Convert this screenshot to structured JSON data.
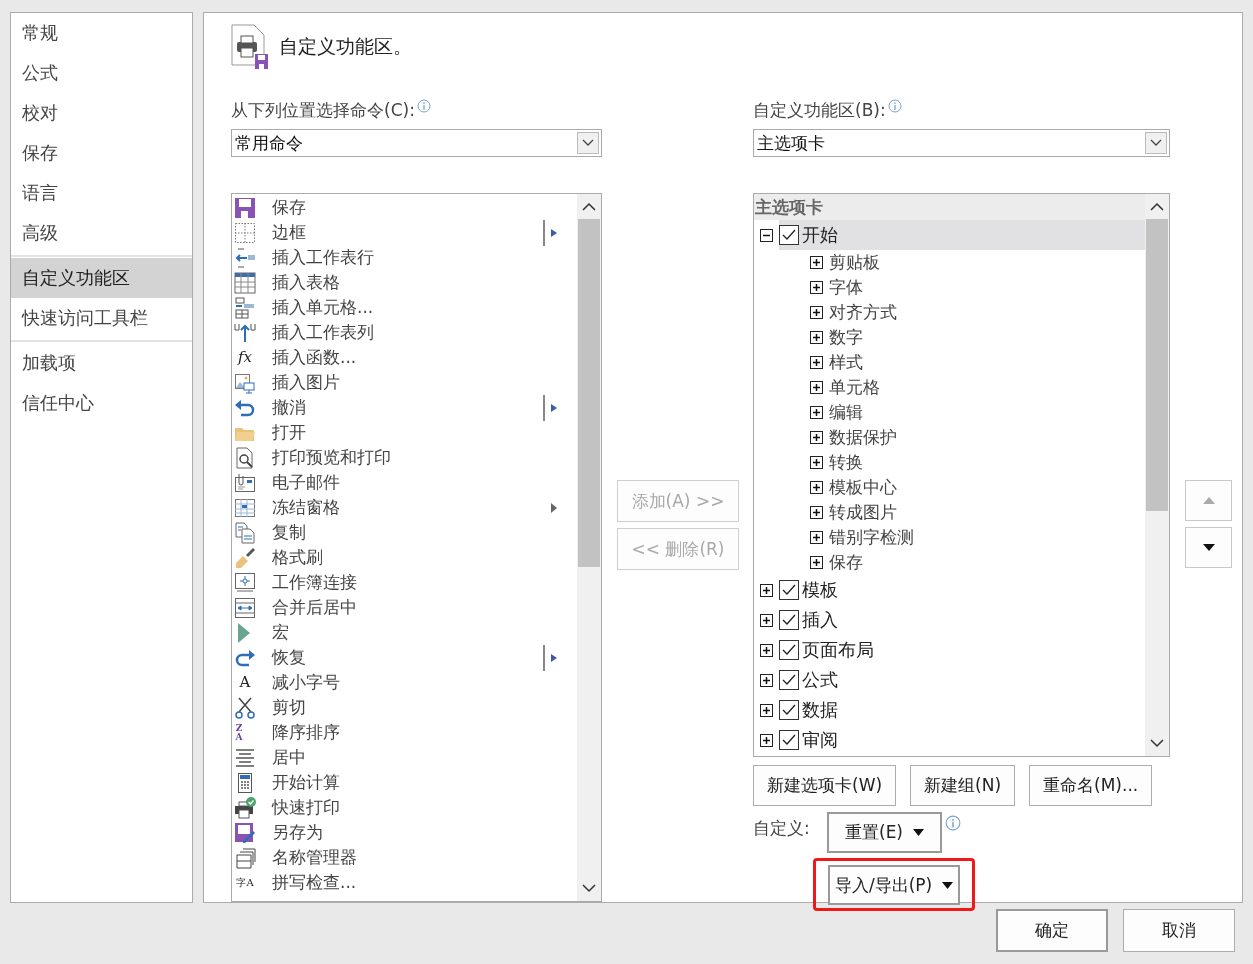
{
  "sidebar": {
    "groups": [
      [
        {
          "label": "常规",
          "selected": false
        },
        {
          "label": "公式",
          "selected": false
        },
        {
          "label": "校对",
          "selected": false
        },
        {
          "label": "保存",
          "selected": false
        },
        {
          "label": "语言",
          "selected": false
        },
        {
          "label": "高级",
          "selected": false
        }
      ],
      [
        {
          "label": "自定义功能区",
          "selected": true
        },
        {
          "label": "快速访问工具栏",
          "selected": false
        }
      ],
      [
        {
          "label": "加载项",
          "selected": false
        },
        {
          "label": "信任中心",
          "selected": false
        }
      ]
    ]
  },
  "header": {
    "title": "自定义功能区。"
  },
  "commands": {
    "label": "从下列位置选择命令(C):",
    "dropdown": {
      "value": "常用命令"
    },
    "items": [
      {
        "label": "保存"
      },
      {
        "label": "边框",
        "kind": "split"
      },
      {
        "label": "插入工作表行"
      },
      {
        "label": "插入表格"
      },
      {
        "label": "插入单元格..."
      },
      {
        "label": "插入工作表列"
      },
      {
        "label": "插入函数...",
        "glyph": "fx"
      },
      {
        "label": "插入图片"
      },
      {
        "label": "撤消",
        "kind": "split"
      },
      {
        "label": "打开"
      },
      {
        "label": "打印预览和打印"
      },
      {
        "label": "电子邮件"
      },
      {
        "label": "冻结窗格",
        "kind": "menu"
      },
      {
        "label": "复制"
      },
      {
        "label": "格式刷"
      },
      {
        "label": "工作簿连接"
      },
      {
        "label": "合并后居中"
      },
      {
        "label": "宏"
      },
      {
        "label": "恢复",
        "kind": "split"
      },
      {
        "label": "减小字号",
        "glyph": "A"
      },
      {
        "label": "剪切"
      },
      {
        "label": "降序排序",
        "glyph": "ZA"
      },
      {
        "label": "居中"
      },
      {
        "label": "开始计算"
      },
      {
        "label": "快速打印"
      },
      {
        "label": "另存为"
      },
      {
        "label": "名称管理器"
      },
      {
        "label": "拼写检查...",
        "glyph": "字A"
      }
    ]
  },
  "transfer_buttons": [
    {
      "label": "添加(A) >>",
      "disabled": true
    },
    {
      "label": "<< 删除(R)",
      "disabled": true
    }
  ],
  "ribbon": {
    "label": "自定义功能区(B):",
    "dropdown": {
      "value": "主选项卡"
    },
    "tree": {
      "heading": "主选项卡",
      "tabs": [
        {
          "label": "开始",
          "checked": true,
          "expanded": true,
          "selected": true,
          "children": [
            {
              "label": "剪贴板",
              "expanded": false
            },
            {
              "label": "字体",
              "expanded": false
            },
            {
              "label": "对齐方式",
              "expanded": false
            },
            {
              "label": "数字",
              "expanded": false
            },
            {
              "label": "样式",
              "expanded": false
            },
            {
              "label": "单元格",
              "expanded": false
            },
            {
              "label": "编辑",
              "expanded": false
            },
            {
              "label": "数据保护",
              "expanded": false
            },
            {
              "label": "转换",
              "expanded": false
            },
            {
              "label": "模板中心",
              "expanded": false
            },
            {
              "label": "转成图片",
              "expanded": false
            },
            {
              "label": "错别字检测",
              "expanded": false
            },
            {
              "label": "保存",
              "expanded": false
            }
          ]
        },
        {
          "label": "模板",
          "checked": true,
          "expanded": false,
          "selected": false
        },
        {
          "label": "插入",
          "checked": true,
          "expanded": false,
          "selected": false
        },
        {
          "label": "页面布局",
          "checked": true,
          "expanded": false,
          "selected": false
        },
        {
          "label": "公式",
          "checked": true,
          "expanded": false,
          "selected": false
        },
        {
          "label": "数据",
          "checked": true,
          "expanded": false,
          "selected": false
        },
        {
          "label": "审阅",
          "checked": true,
          "expanded": false,
          "selected": false
        }
      ]
    },
    "buttons": [
      "新建选项卡(W)",
      "新建组(N)",
      "重命名(M)..."
    ],
    "customize": {
      "label": "自定义:",
      "reset": "重置(E)",
      "import_export": "导入/导出(P)",
      "highlighted": true
    }
  },
  "move_buttons": [
    {
      "kind": "up",
      "disabled": true
    },
    {
      "kind": "down",
      "disabled": false
    }
  ],
  "footer": {
    "buttons": [
      "确定",
      "取消"
    ]
  }
}
